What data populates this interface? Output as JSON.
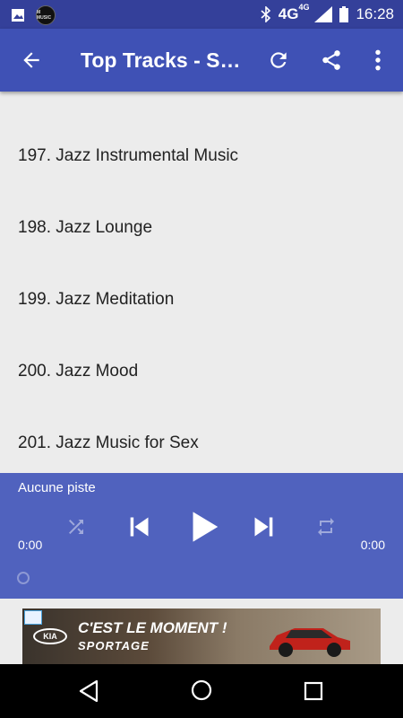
{
  "status_bar": {
    "time": "16:28",
    "network": "4G",
    "network_sup": "4G",
    "icons": [
      "image-icon",
      "app-logo-icon",
      "bluetooth-icon",
      "signal-icon",
      "battery-icon"
    ],
    "app_logo_text": "M MUSIC"
  },
  "app_bar": {
    "title": "Top Tracks - Spotify",
    "back_icon": "arrow-back-icon",
    "refresh_icon": "refresh-icon",
    "share_icon": "share-icon",
    "more_icon": "more-vert-icon",
    "background": "#3f51b5"
  },
  "tracks": [
    {
      "label": "197. Jazz Instrumental Music"
    },
    {
      "label": "198. Jazz Lounge"
    },
    {
      "label": "199. Jazz Meditation"
    },
    {
      "label": "200. Jazz Mood"
    },
    {
      "label": "201. Jazz Music for Sex"
    }
  ],
  "player": {
    "status_text": "Aucune piste",
    "time_elapsed": "0:00",
    "time_total": "0:00",
    "background": "#5062be"
  },
  "ad": {
    "brand": "KIA",
    "headline": "C'EST LE MOMENT !",
    "subline": "SPORTAGE"
  }
}
